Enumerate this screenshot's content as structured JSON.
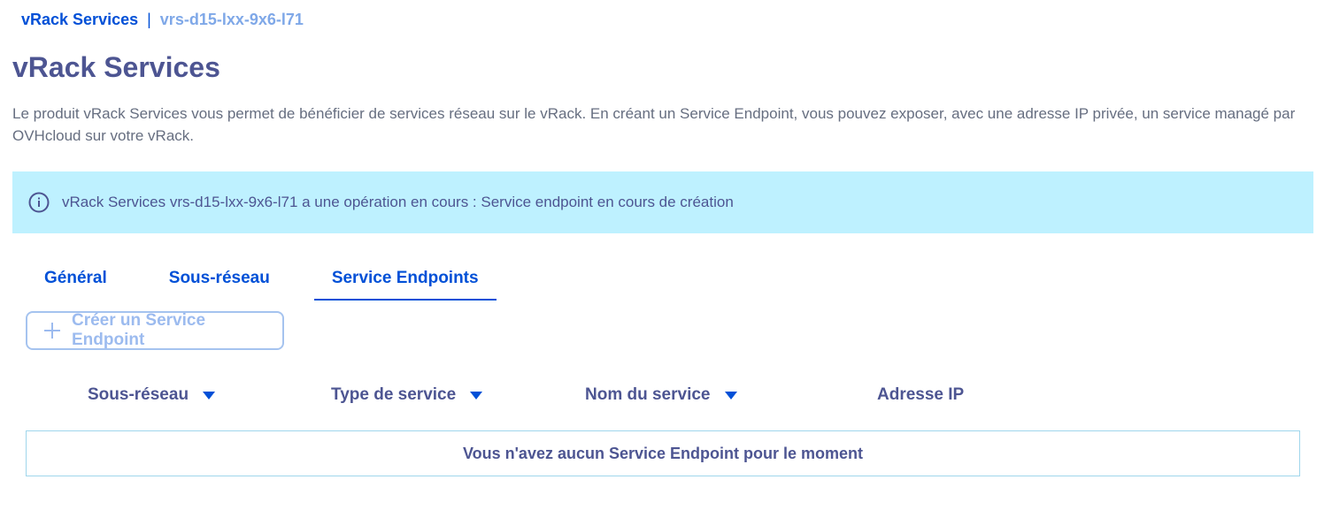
{
  "breadcrumb": {
    "root": "vRack Services",
    "separator": "|",
    "current": "vrs-d15-lxx-9x6-l71"
  },
  "page": {
    "title": "vRack Services",
    "description": "Le produit vRack Services vous permet de bénéficier de services réseau sur le vRack. En créant un Service Endpoint, vous pouvez exposer, avec une adresse IP privée, un service managé par OVHcloud sur votre vRack."
  },
  "banner": {
    "icon": "info-icon",
    "text": "vRack Services vrs-d15-lxx-9x6-l71 a une opération en cours : Service endpoint en cours de création"
  },
  "tabs": [
    {
      "label": "Général",
      "active": false
    },
    {
      "label": "Sous-réseau",
      "active": false
    },
    {
      "label": "Service Endpoints",
      "active": true
    }
  ],
  "actions": {
    "create_label": "Créer un Service Endpoint",
    "create_icon": "plus-icon",
    "disabled": true
  },
  "table": {
    "columns": [
      {
        "label": "Sous-réseau",
        "sortable": true
      },
      {
        "label": "Type de service",
        "sortable": true
      },
      {
        "label": "Nom du service",
        "sortable": true
      },
      {
        "label": "Adresse IP",
        "sortable": false
      }
    ],
    "empty_message": "Vous n'avez aucun Service Endpoint pour le moment"
  },
  "colors": {
    "primary": "#0050d7",
    "heading": "#4d5592",
    "banner_bg": "#bef1ff",
    "body_text": "#666e80",
    "disabled": "#9cbbef"
  }
}
